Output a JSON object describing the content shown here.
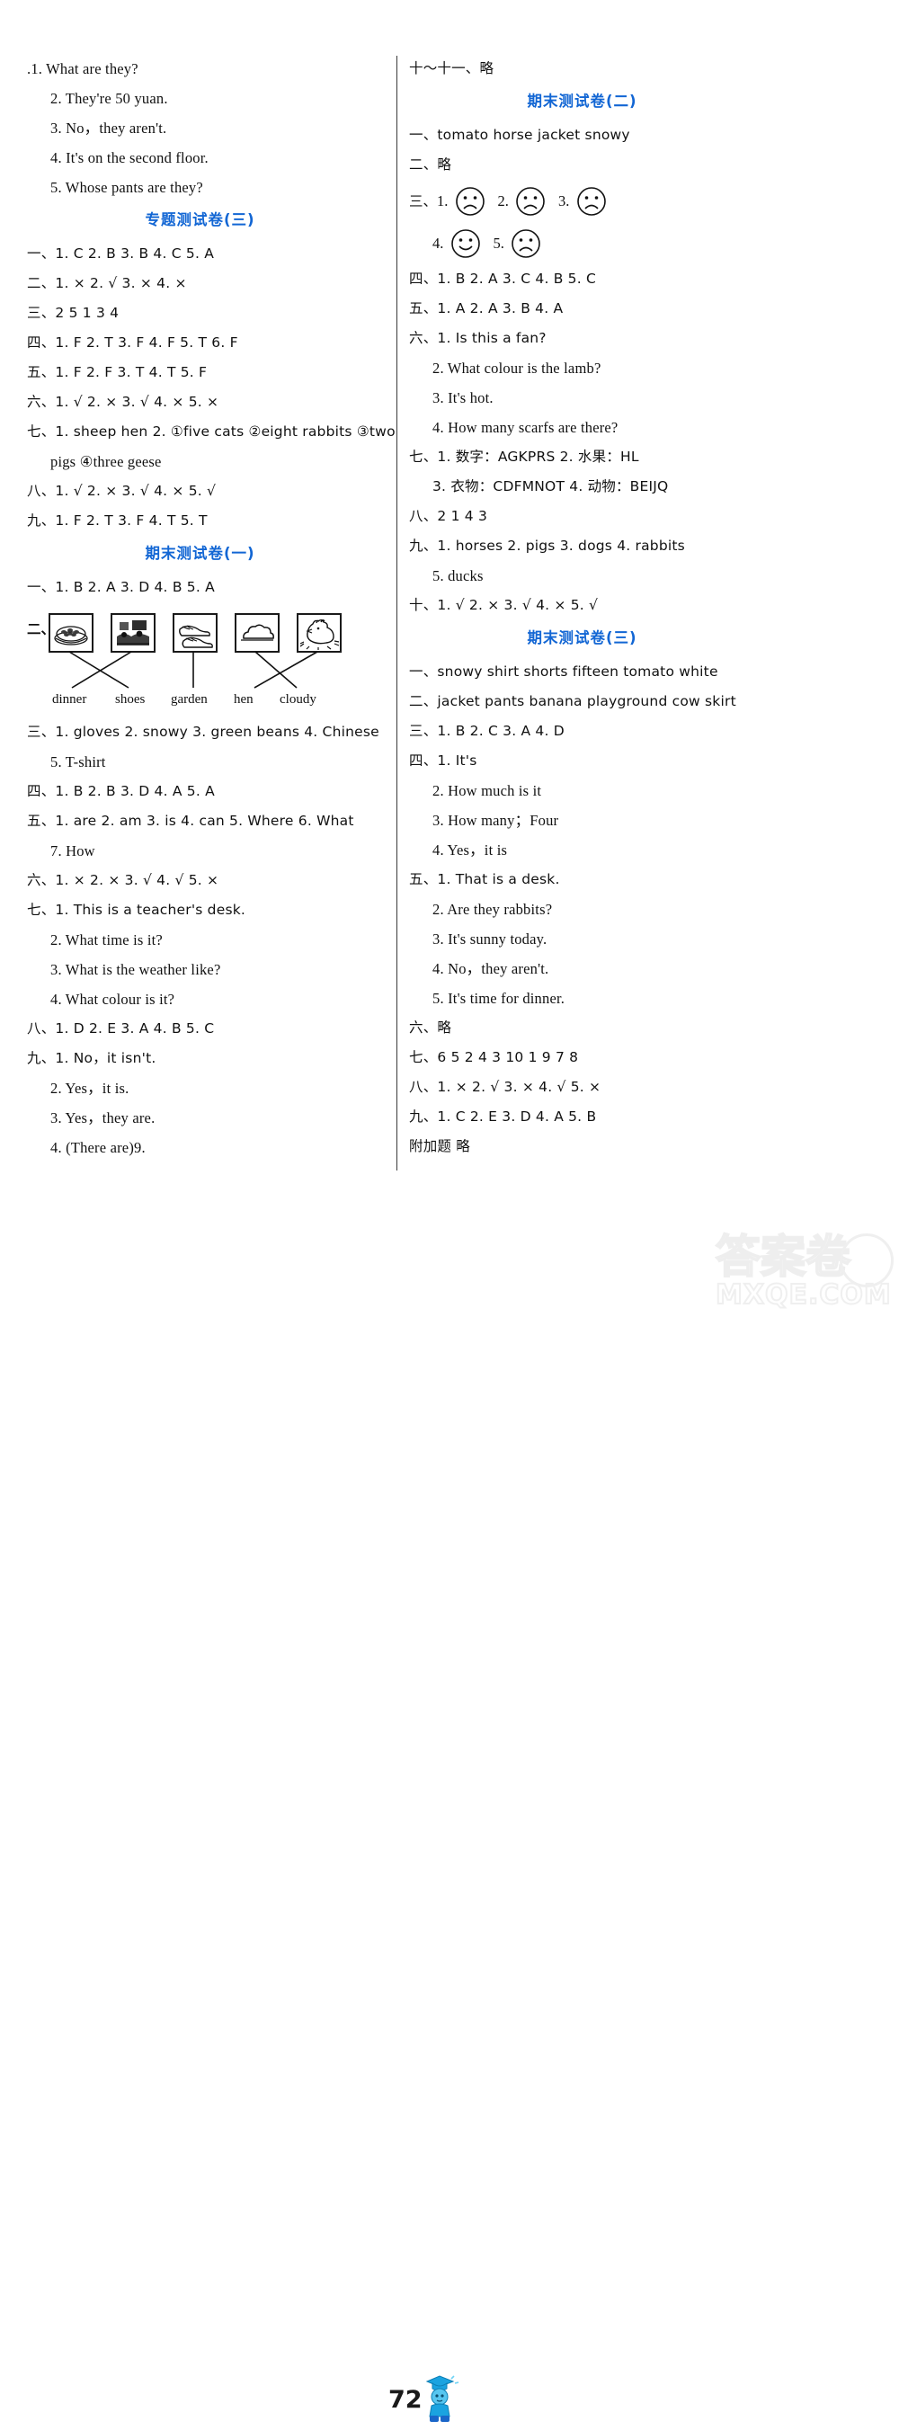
{
  "page": {
    "number": "72",
    "watermark_cn": "答案卷",
    "watermark_en": "MXQE.COM"
  },
  "left_column": {
    "top_answers": [
      ".1. What are they?",
      "2. They're 50 yuan.",
      "3. No，they aren't.",
      "4. It's on the second floor.",
      "5. Whose pants are they?"
    ],
    "section_zhuanti3": {
      "title": "专题测试卷(三)",
      "items": [
        "一、1. C   2. B   3. B   4. C   5. A",
        "二、1. ×   2. √   3. ×   4. ×",
        "三、2   5   1   3   4",
        "四、1. F   2. T   3. F   4. F   5. T   6. F",
        "五、1. F   2. F   3. T   4. T   5. F",
        "六、1. √   2. ×   3. √   4. ×   5. ×",
        "七、1. sheep   hen   2. ①five cats   ②eight rabbits   ③two",
        "pigs   ④three geese",
        "八、1. √   2. ×   3. √   4. ×   5. √",
        "九、1. F   2. T   3. F   4. T   5. T"
      ]
    },
    "section_qimo1": {
      "title": "期末测试卷(一)",
      "q1": "一、1. B   2. A   3. D   4. B   5. A",
      "q2_head": "二、",
      "q2_pictures": [
        {
          "name": "plate-of-green-beans",
          "label_for": "green beans"
        },
        {
          "name": "garden-scene",
          "label_for": "garden"
        },
        {
          "name": "pair-of-shoes",
          "label_for": "shoes"
        },
        {
          "name": "cloud",
          "label_for": "cloudy"
        },
        {
          "name": "hen",
          "label_for": "hen"
        }
      ],
      "q2_labels": [
        "dinner",
        "shoes",
        "garden",
        "hen",
        "cloudy"
      ],
      "items": [
        "三、1. gloves   2. snowy   3. green beans   4. Chinese",
        "5. T-shirt",
        "四、1. B   2. B   3. D   4. A   5. A",
        "五、1. are   2. am   3. is   4. can   5. Where   6. What",
        "7. How",
        "六、1. ×   2. ×   3. √   4. √   5. ×",
        "七、1. This is a teacher's desk.",
        "2. What time is it?",
        "3. What is the weather like?",
        "4. What colour is it?",
        "八、1. D   2. E   3. A   4. B   5. C",
        "九、1. No，it isn't.",
        "2. Yes，it is.",
        "3. Yes，they are.",
        "4. (There are)9."
      ]
    }
  },
  "right_column": {
    "continued": "十～十一、略",
    "section_qimo2": {
      "title": "期末测试卷(二)",
      "q1": "一、tomato   horse   jacket   snowy",
      "q2": "二、略",
      "q3_head": "三、",
      "q3_faces": [
        {
          "num": "1.",
          "face": "sad"
        },
        {
          "num": "2.",
          "face": "sad"
        },
        {
          "num": "3.",
          "face": "sad"
        },
        {
          "num": "4.",
          "face": "happy"
        },
        {
          "num": "5.",
          "face": "sad"
        }
      ],
      "items": [
        "四、1. B   2. A   3. C   4. B   5. C",
        "五、1. A   2. A   3. B   4. A",
        "六、1. Is this a fan?",
        "2. What colour is the lamb?",
        "3. It's hot.",
        "4. How many scarfs are there?",
        "七、1. 数字：AGKPRS   2. 水果：HL",
        "3. 衣物：CDFMNOT   4. 动物：BEIJQ",
        "八、2   1   4   3",
        "九、1. horses   2. pigs   3. dogs   4. rabbits",
        "5. ducks",
        "十、1. √   2. ×   3. √   4. ×   5. √"
      ]
    },
    "section_qimo3": {
      "title": "期末测试卷(三)",
      "items": [
        "一、snowy   shirt   shorts   fifteen   tomato   white",
        "二、jacket   pants   banana   playground   cow   skirt",
        "三、1. B   2. C   3. A   4. D",
        "四、1. It's",
        "2. How much is it",
        "3. How many；Four",
        "4. Yes，it is",
        "五、1. That is a desk.",
        "2. Are they rabbits?",
        "3. It's sunny today.",
        "4. No，they aren't.",
        "5. It's time for dinner.",
        "六、略",
        "七、6   5   2   4   3   10   1   9   7   8",
        "八、1. ×   2. √   3. ×   4. √   5. ×",
        "九、1. C   2. E   3. D   4. A   5. B",
        "附加题   略"
      ]
    }
  }
}
